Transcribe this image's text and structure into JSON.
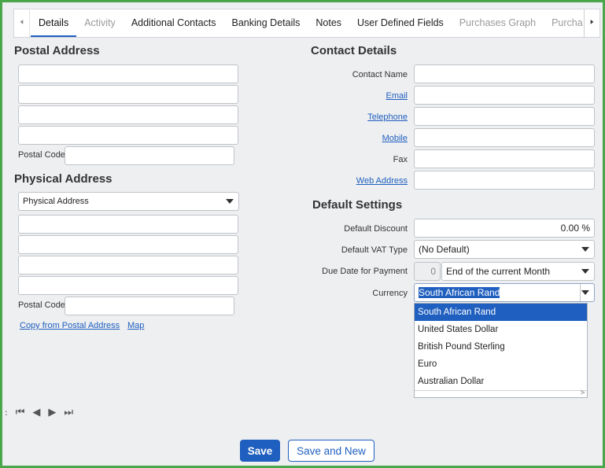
{
  "tabs": [
    {
      "label": "Details"
    },
    {
      "label": "Activity"
    },
    {
      "label": "Additional Contacts"
    },
    {
      "label": "Banking Details"
    },
    {
      "label": "Notes"
    },
    {
      "label": "User Defined Fields"
    },
    {
      "label": "Purchases Graph"
    },
    {
      "label": "Purchase C"
    }
  ],
  "postal": {
    "title": "Postal Address",
    "postal_code_label": "Postal Code",
    "line1": "",
    "line2": "",
    "line3": "",
    "line4": "",
    "postal_code": ""
  },
  "physical": {
    "title": "Physical Address",
    "type_select": "Physical Address",
    "postal_code_label": "Postal Code",
    "copy_link": "Copy from Postal Address",
    "map_link": "Map"
  },
  "contact": {
    "title": "Contact Details",
    "contact_name_label": "Contact Name",
    "email_label": "Email",
    "telephone_label": "Telephone",
    "mobile_label": "Mobile",
    "fax_label": "Fax",
    "web_label": "Web Address"
  },
  "defaults": {
    "title": "Default Settings",
    "discount_label": "Default Discount",
    "discount_value": "0.00 %",
    "vat_label": "Default VAT Type",
    "vat_value": "(No Default)",
    "due_label": "Due Date for Payment",
    "due_days": "0",
    "due_value": "End of the current Month",
    "currency_label": "Currency",
    "currency_value": "South African Rand",
    "currency_options": [
      "South African Rand",
      "United States Dollar",
      "British Pound Sterling",
      "Euro",
      "Australian Dollar"
    ]
  },
  "pager": {
    "colon": ":"
  },
  "buttons": {
    "save": "Save",
    "save_new": "Save and New"
  },
  "colors": {
    "accent": "#1f5fbf",
    "frame": "#4aa64a"
  }
}
